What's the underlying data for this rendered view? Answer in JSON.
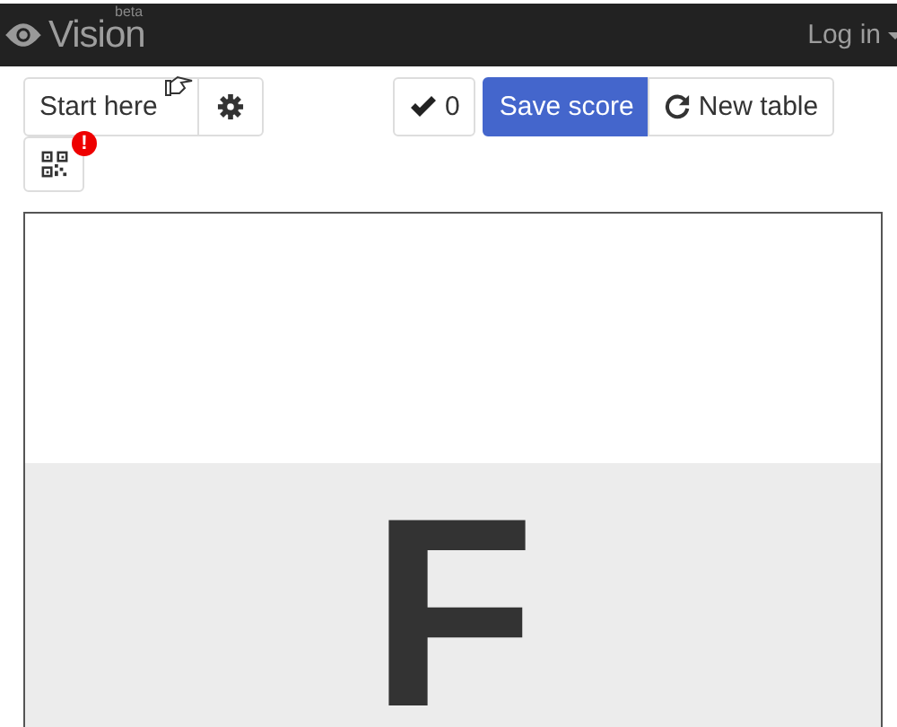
{
  "navbar": {
    "brand": "Vision",
    "badge": "beta",
    "login": "Log in"
  },
  "toolbar": {
    "start": "Start here",
    "count": "0",
    "save": "Save score",
    "new_table": "New table",
    "qr_alert": "!"
  },
  "card": {
    "letter": "F"
  }
}
